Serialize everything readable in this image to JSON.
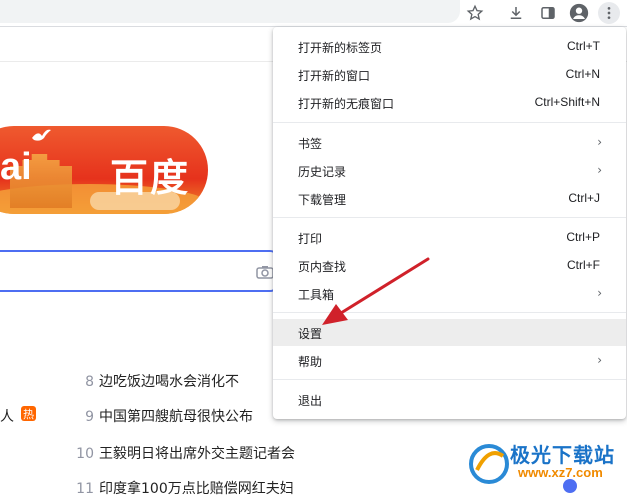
{
  "menu": {
    "items": [
      {
        "label": "打开新的标签页",
        "shortcut": "Ctrl+T"
      },
      {
        "label": "打开新的窗口",
        "shortcut": "Ctrl+N"
      },
      {
        "label": "打开新的无痕窗口",
        "shortcut": "Ctrl+Shift+N"
      },
      {
        "label": "书签",
        "submenu": true
      },
      {
        "label": "历史记录",
        "submenu": true
      },
      {
        "label": "下载管理",
        "shortcut": "Ctrl+J"
      },
      {
        "label": "打印",
        "shortcut": "Ctrl+P"
      },
      {
        "label": "页内查找",
        "shortcut": "Ctrl+F"
      },
      {
        "label": "工具箱",
        "submenu": true
      },
      {
        "label": "设置",
        "highlighted": true
      },
      {
        "label": "帮助",
        "submenu": true
      },
      {
        "label": "退出"
      }
    ],
    "chevron": "›"
  },
  "logo": {
    "latin": "ai",
    "chinese": "百度"
  },
  "hot_list": [
    {
      "rank": "8",
      "text": "边吃饭边喝水会消化不"
    },
    {
      "rank": "9",
      "text": "中国第四艘航母很快公布"
    },
    {
      "rank": "10",
      "text": "王毅明日将出席外交主题记者会"
    },
    {
      "rank": "11",
      "text": "印度拿100万点比赔偿网红夫妇"
    }
  ],
  "left_fragment": {
    "text": "人",
    "badge": "热"
  },
  "toolbar_icons": [
    "star-icon",
    "download-icon",
    "sidebar-icon",
    "profile-icon",
    "more-menu-icon"
  ],
  "watermark": {
    "text": "极光下载站",
    "url": "www.xz7.com"
  },
  "colors": {
    "accent": "#4e6ef2",
    "arrow": "#d0212a",
    "highlight": "#ededed",
    "logo": "#e6321c"
  }
}
